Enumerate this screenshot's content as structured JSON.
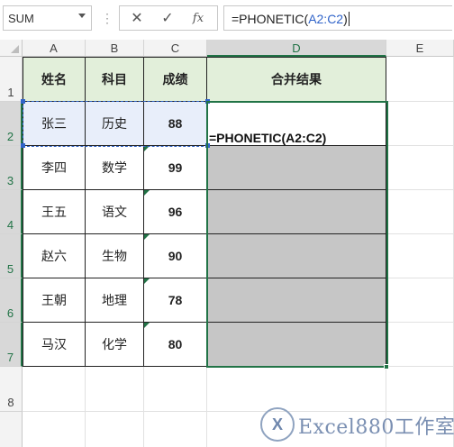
{
  "formula_bar": {
    "name_box": "SUM",
    "formula_prefix": "=PHONETIC(",
    "formula_ref": "A2:C2",
    "formula_suffix": ")"
  },
  "columns": [
    "A",
    "B",
    "C",
    "D",
    "E"
  ],
  "rows": [
    "1",
    "2",
    "3",
    "4",
    "5",
    "6",
    "7",
    "8"
  ],
  "table": {
    "headers": [
      "姓名",
      "科目",
      "成绩",
      "合并结果"
    ],
    "rows": [
      [
        "张三",
        "历史",
        "88"
      ],
      [
        "李四",
        "数学",
        "99"
      ],
      [
        "王五",
        "语文",
        "96"
      ],
      [
        "赵六",
        "生物",
        "90"
      ],
      [
        "王朝",
        "地理",
        "78"
      ],
      [
        "马汉",
        "化学",
        "80"
      ]
    ]
  },
  "active_cell_formula": "=PHONETIC(A2:C2)",
  "watermark": {
    "logo": "X",
    "text": "Excel880工作室"
  },
  "colors": {
    "accent_green": "#217346",
    "header_fill": "#e2efda",
    "ref_blue": "#2f63c9",
    "grey_fill": "#c6c6c6"
  }
}
